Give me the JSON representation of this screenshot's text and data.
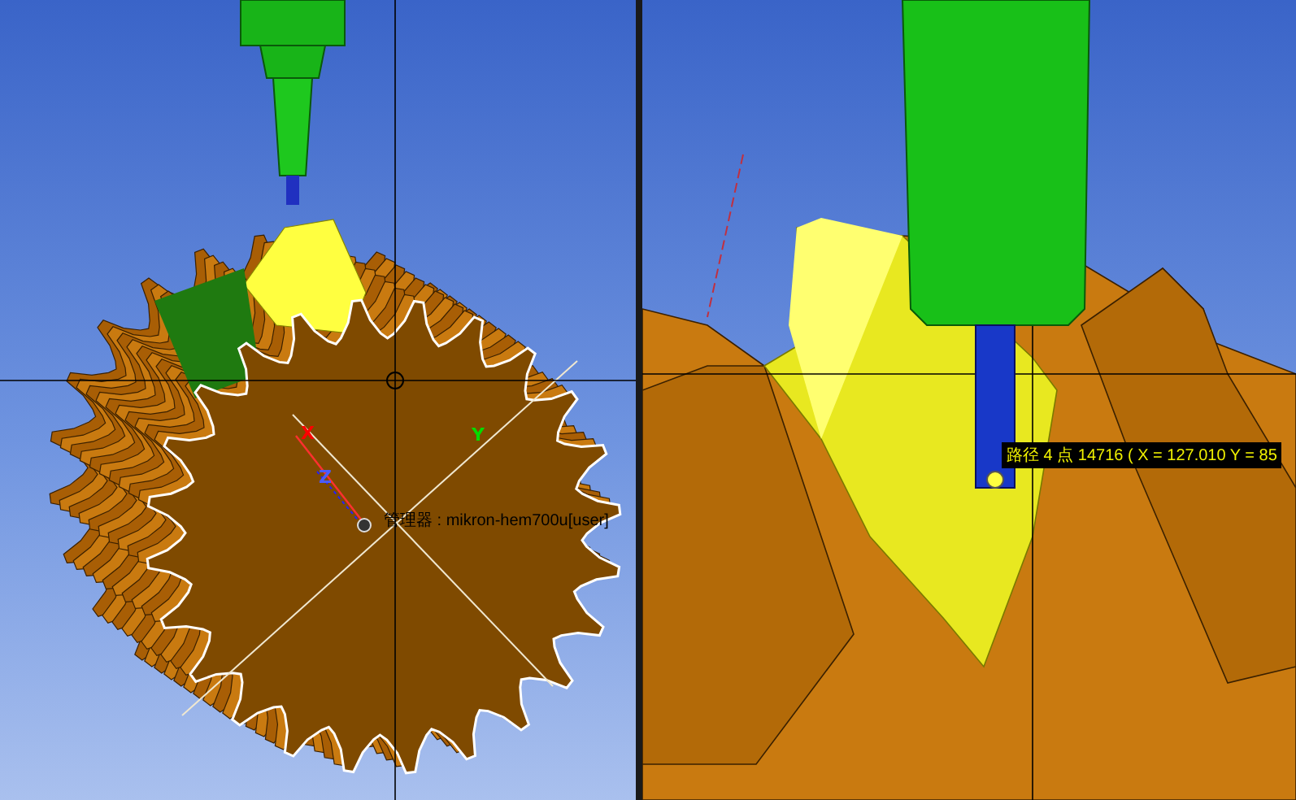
{
  "left_view": {
    "axis_labels": [
      {
        "text": "X",
        "color": "#ff0000"
      },
      {
        "text": "Y",
        "color": "#00dd00"
      },
      {
        "text": "Z",
        "color": "#4a5cff"
      }
    ],
    "machine_label": "管理器 : mikron-hem700u[user]"
  },
  "right_view": {
    "tooltip": "路径 4 点 14716 ( X = 127.010  Y = 85"
  }
}
